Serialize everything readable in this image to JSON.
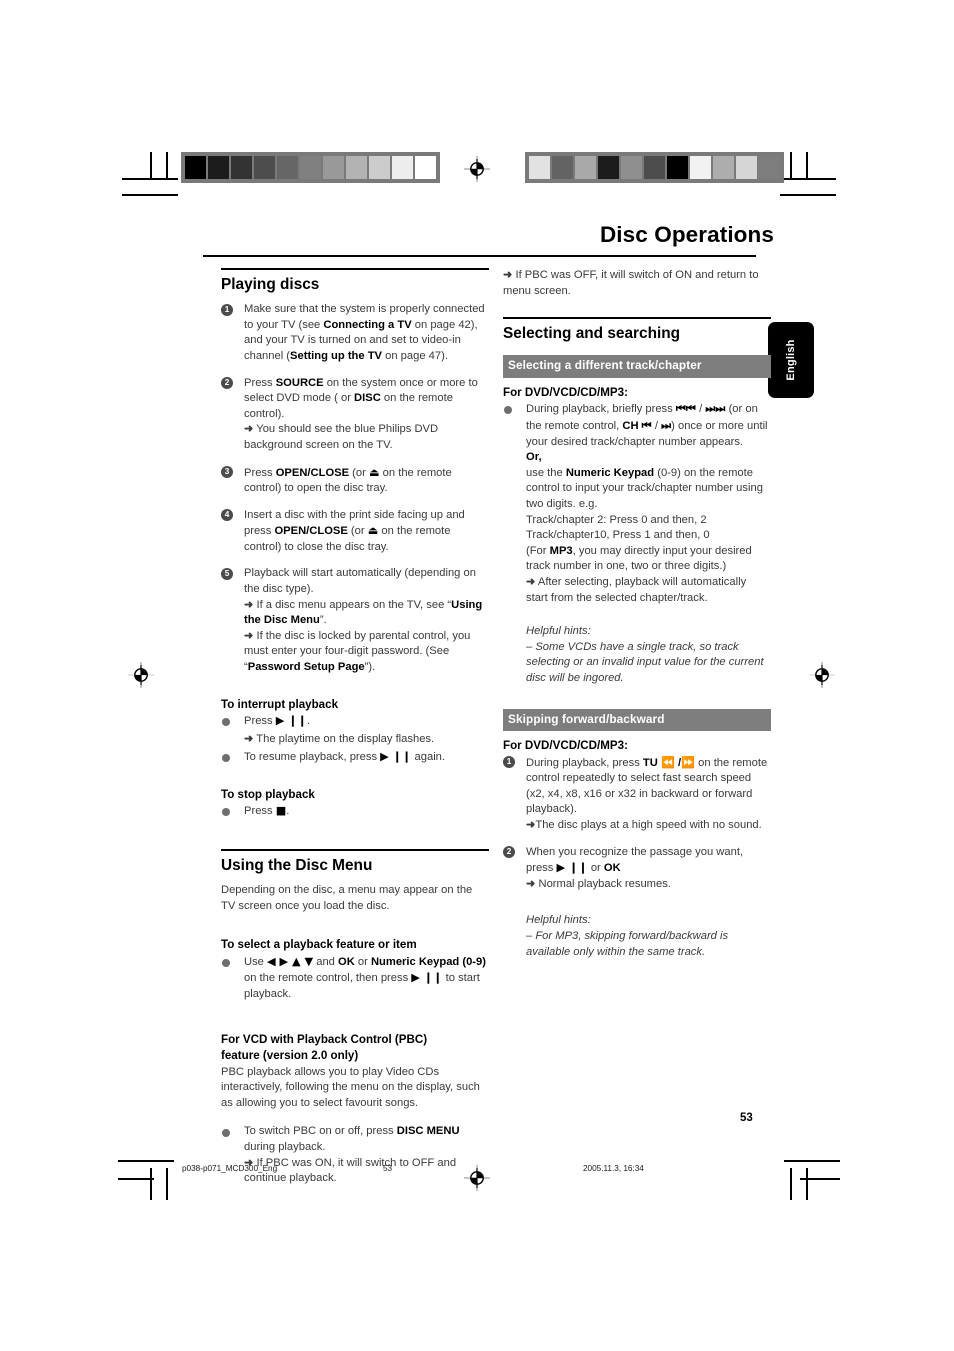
{
  "document": {
    "title": "Disc Operations",
    "language_tab": "English",
    "page_number": "53"
  },
  "footer": {
    "file": "p038-p071_MCD300_Eng",
    "page": "53",
    "date": "2005.11.3, 16:34"
  },
  "calibration": {
    "left_bar": [
      "#000000",
      "#1c1c1c",
      "#333333",
      "#4d4d4d",
      "#666666",
      "#808080",
      "#999999",
      "#b3b3b3",
      "#cccccc",
      "#ededed",
      "#ffffff"
    ],
    "right_bar": [
      "#e2e2e2",
      "#636363",
      "#a9a9a9",
      "#1c1c1c",
      "#8f8f8f",
      "#4d4d4d",
      "#000000",
      "#f2f2f2",
      "#adadad",
      "#d6d6d6",
      "#7d7d7d"
    ]
  },
  "left_column": {
    "heading": "Playing discs",
    "steps": [
      {
        "num": "1",
        "html": "Make sure that the system is properly connected to your TV (see <b>Connecting a TV</b> on page 42), and your TV is turned on and set to video-in channel (<b>Setting up the TV</b> on page 47)."
      },
      {
        "num": "2",
        "html": "Press <b>SOURCE</b> on the system once or more to select DVD mode ( or <b>DISC</b> on the remote control).<br><span class=\"arrow\">➜</span> You should see the blue Philips DVD background screen on the TV."
      },
      {
        "num": "3",
        "html": "Press <b>OPEN/CLOSE</b> (or <b class=\"glyph\">⏏</b> on the remote control) to open the disc tray."
      },
      {
        "num": "4",
        "html": "Insert a disc with the print side facing up and press <b>OPEN/CLOSE</b> (or <b class=\"glyph\">⏏</b> on the remote control) to close the disc tray."
      },
      {
        "num": "5",
        "html": "Playback will start automatically (depending on the disc type).<br><span class=\"arrow\">➜</span> If a disc menu appears on the TV, see “<b>Using the Disc Menu</b>”.<br><span class=\"arrow\">➜</span> If the disc is locked by parental control, you must enter your four-digit password. (See “<b>Password Setup Page</b>”)."
      }
    ],
    "interrupt_heading": "To interrupt playback",
    "interrupt_items": [
      "Press <span class=\"glyph\"><b>▶ ❙❙</b></span>.",
      "<span class=\"arrow\">➜</span> The playtime on the display flashes.",
      "To resume playback, press <span class=\"glyph\"><b>▶ ❙❙</b></span> again."
    ],
    "stop_heading": "To stop playback",
    "stop_item": "Press <span class=\"glyph\"><b>■</b></span>.",
    "disc_menu_heading": "Using the Disc Menu",
    "disc_menu_intro": "Depending on the disc, a menu may appear on the TV screen once you load the disc.",
    "select_feature_heading": "To select a playback feature or item",
    "select_feature_item": "Use <span class=\"glyph\"><b>◀ ▶ ▲ ▼</b></span> and <b>OK</b> or <b>Numeric Keypad (0-9)</b> on the remote control, then press <span class=\"glyph\"><b>▶ ❙❙</b></span> to start playback.",
    "pbc_heading_line1": "For VCD with Playback Control (PBC)",
    "pbc_heading_line2": "feature (version 2.0 only)",
    "pbc_intro": "PBC playback allows you to play Video CDs interactively, following the menu on the display, such as allowing you to select favourit songs.",
    "pbc_item": "To switch PBC on or off, press <b>DISC MENU</b> during playback.<br><span class=\"arrow\">➜</span> If PBC was ON, it will switch to OFF and continue playback."
  },
  "right_column": {
    "pbc_continued": "<span class=\"arrow\">➜</span> If PBC was  OFF, it will switch of ON and return to menu screen.",
    "heading": "Selecting and searching",
    "band1": "Selecting a different track/chapter",
    "band1_sub": "For DVD/VCD/CD/MP3:",
    "band1_item": "During playback, briefly press <span class=\"glyph\"><b>⏮⏮</b></span> / <span class=\"glyph\"><b>⏭⏭</b></span> (or on the remote control, <b>CH</b> <span class=\"glyph\"><b>⏮</b></span> / <span class=\"glyph\"><b>⏭</b></span>) once or more until your desired track/chapter number appears.",
    "or_label": "Or,",
    "band1_body": "use the <b>Numeric Keypad</b> (0-9) on the remote control to input your track/chapter number using two digits. e.g.<br>Track/chapter 2: Press 0 and then, 2<br>Track/chapter10, Press 1 and then, 0<br>(For <b>MP3</b>, you may directly input your desired track number in one, two or three digits.)<br><span class=\"arrow\">➜</span> After selecting, playback will automatically start from the selected chapter/track.",
    "hint1_title": "Helpful hints:",
    "hint1_body": "–  Some VCDs have a single track,  so track selecting or an invalid input value for the current disc will be ingored.",
    "band2": "Skipping forward/backward",
    "band2_sub": "For DVD/VCD/CD/MP3:",
    "band2_steps": [
      {
        "num": "1",
        "html": "During playback, press <b>TU</b> <span class=\"glyph\"><b>⏪</b></span> <b>/</b><span class=\"glyph\"><b>⏩</b></span>  on the remote control repeatedly to select fast search speed (x2, x4, x8, x16 or x32 in backward or forward playback).<br><span class=\"arrow\">➜</span>The disc plays at a high speed with no sound."
      },
      {
        "num": "2",
        "html": "When you recognize the passage you want, press <span class=\"glyph\"><b>▶ ❙❙</b></span> or <b>OK</b><br><span class=\"arrow\">➜</span> Normal playback resumes."
      }
    ],
    "hint2_title": "Helpful hints:",
    "hint2_body": "–  For MP3, skipping forward/backward is available only within the same track."
  }
}
